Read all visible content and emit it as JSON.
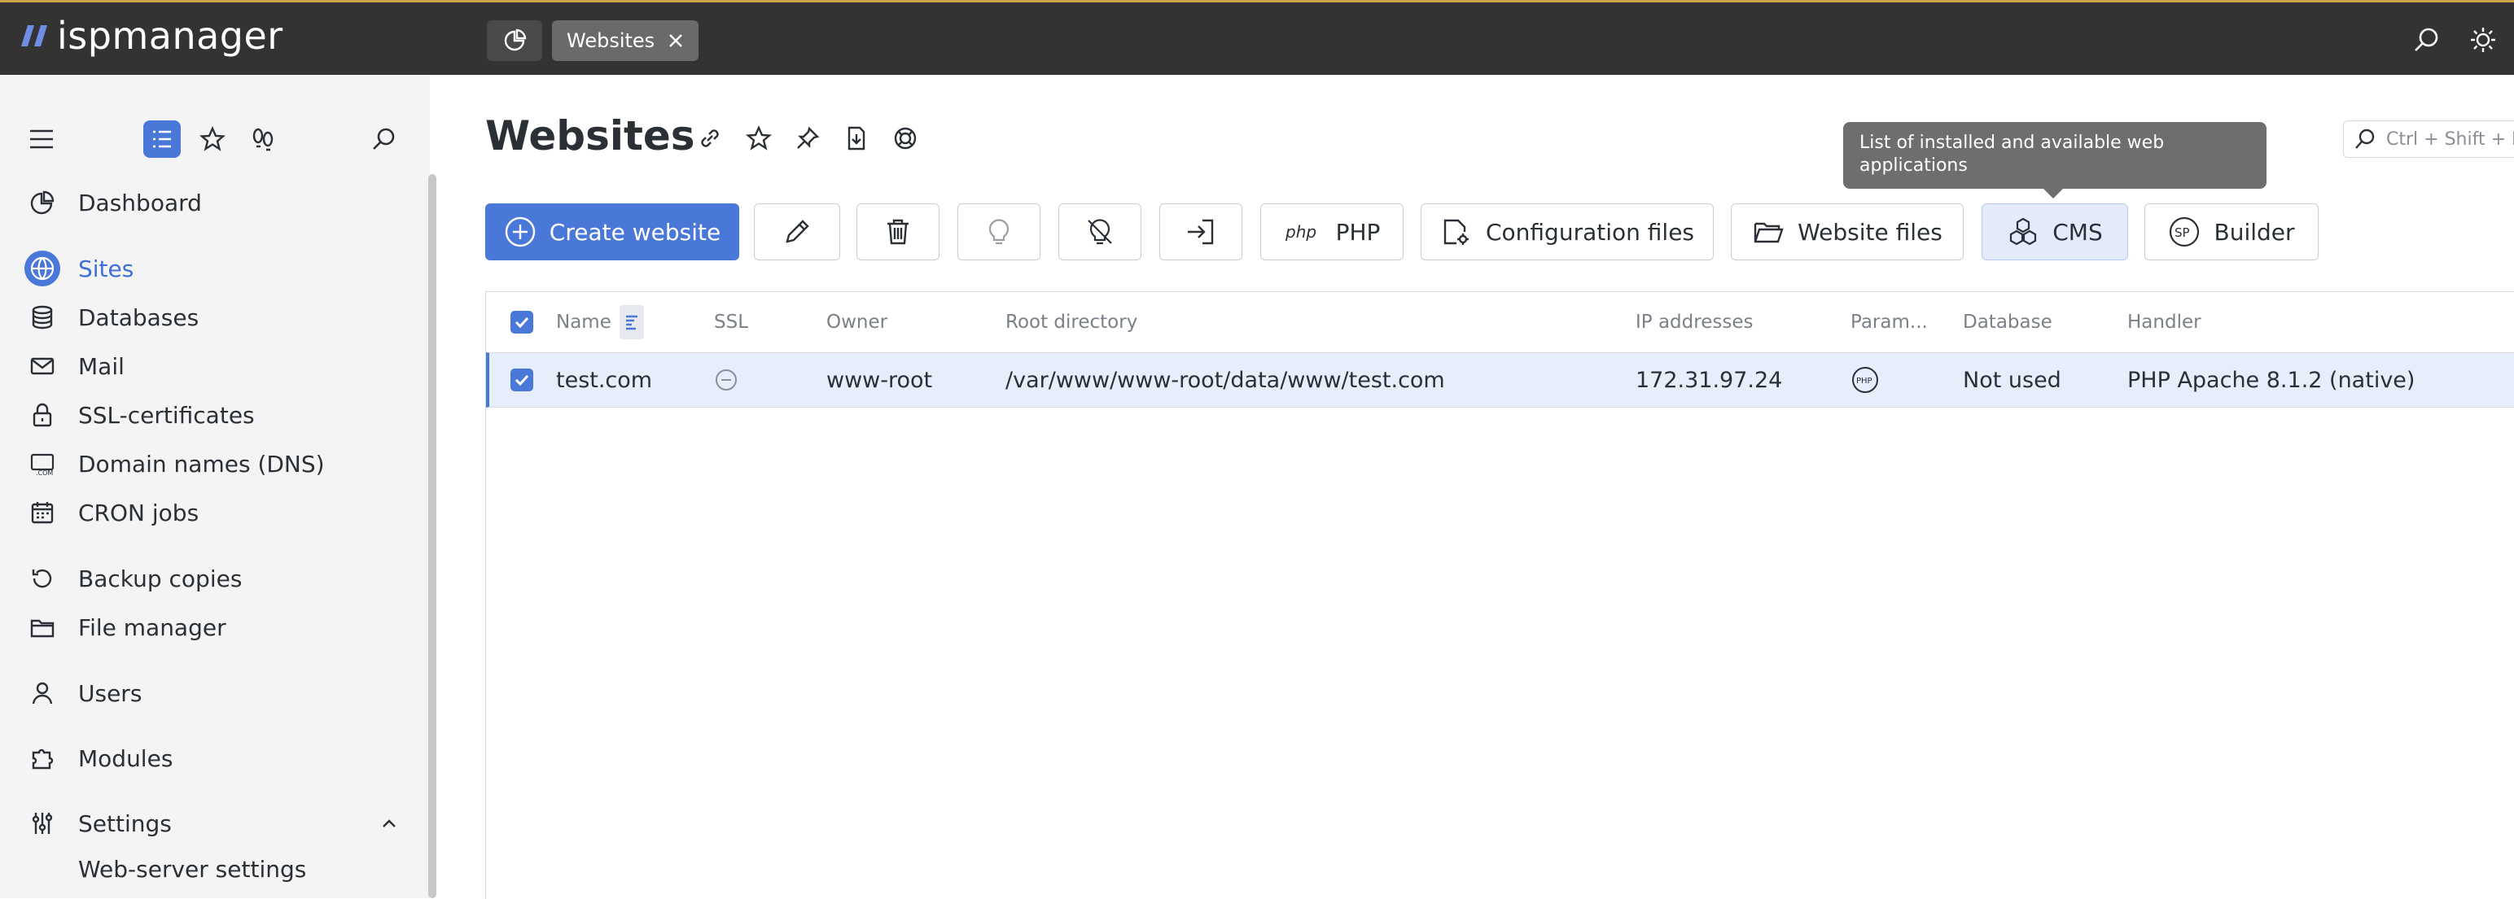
{
  "app": {
    "name": "ispmanager"
  },
  "tabs": {
    "active_label": "Websites"
  },
  "page": {
    "title": "Websites"
  },
  "search": {
    "placeholder": "Ctrl + Shift + F"
  },
  "tooltip": {
    "text": "List of installed and available web applications"
  },
  "sidebar": {
    "items": [
      {
        "label": "Dashboard",
        "icon": "dashboard-icon"
      },
      {
        "label": "Sites",
        "icon": "globe-icon",
        "active": true
      },
      {
        "label": "Databases",
        "icon": "database-icon"
      },
      {
        "label": "Mail",
        "icon": "mail-icon"
      },
      {
        "label": "SSL-certificates",
        "icon": "lock-icon"
      },
      {
        "label": "Domain names (DNS)",
        "icon": "dns-icon"
      },
      {
        "label": "CRON jobs",
        "icon": "calendar-icon"
      },
      {
        "label": "Backup copies",
        "icon": "backup-icon"
      },
      {
        "label": "File manager",
        "icon": "folder-icon"
      },
      {
        "label": "Users",
        "icon": "user-icon"
      },
      {
        "label": "Modules",
        "icon": "puzzle-icon"
      },
      {
        "label": "Settings",
        "icon": "settings-icon"
      }
    ],
    "sub_item": "Web-server settings"
  },
  "toolbar": {
    "create_label": "Create website",
    "php_label": "PHP",
    "config_label": "Configuration files",
    "files_label": "Website files",
    "cms_label": "CMS",
    "builder_label": "Builder"
  },
  "table": {
    "columns": [
      "Name",
      "SSL",
      "Owner",
      "Root directory",
      "IP addresses",
      "Param...",
      "Database",
      "Handler"
    ],
    "rows": [
      {
        "name": "test.com",
        "ssl": "none",
        "owner": "www-root",
        "root": "/var/www/www-root/data/www/test.com",
        "ip": "172.31.97.24",
        "param": "PHP",
        "database": "Not used",
        "handler": "PHP Apache 8.1.2 (native)"
      }
    ]
  },
  "colors": {
    "accent": "#4a78d8",
    "topbar": "#333333",
    "sidebar": "#f4f4f4",
    "selected_row": "#e6eefc"
  }
}
